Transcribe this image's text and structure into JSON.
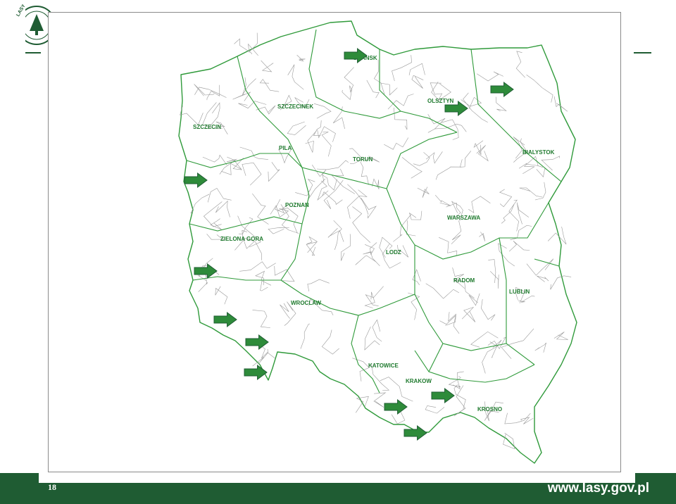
{
  "page_number": "18",
  "website": "www.lasy.gov.pl",
  "logo": {
    "text": "LASY P",
    "color": "#1f5c33"
  },
  "colors": {
    "brand_green": "#1f5c33",
    "boundary_green": "#2f9a3a",
    "arrow_green": "#2e8b3a",
    "label_green": "#1f7a2e"
  },
  "map": {
    "regions": [
      {
        "name": "SZCZECINEK",
        "lon": 16.7,
        "lat": 53.7
      },
      {
        "name": "GDANSK",
        "lon": 18.6,
        "lat": 54.35
      },
      {
        "name": "OLSZTYN",
        "lon": 20.5,
        "lat": 53.78
      },
      {
        "name": "BIALYSTOK",
        "lon": 22.9,
        "lat": 53.1
      },
      {
        "name": "SZCZECIN",
        "lon": 14.55,
        "lat": 53.43
      },
      {
        "name": "PILA",
        "lon": 16.74,
        "lat": 53.15
      },
      {
        "name": "TORUN",
        "lon": 18.6,
        "lat": 53.0
      },
      {
        "name": "WARSZAWA",
        "lon": 21.0,
        "lat": 52.23
      },
      {
        "name": "POZNAN",
        "lon": 16.9,
        "lat": 52.4
      },
      {
        "name": "LODZ",
        "lon": 19.45,
        "lat": 51.77
      },
      {
        "name": "ZIELONA GORA",
        "lon": 15.25,
        "lat": 51.95
      },
      {
        "name": "RADOM",
        "lon": 21.15,
        "lat": 51.4
      },
      {
        "name": "LUBLIN",
        "lon": 22.57,
        "lat": 51.25
      },
      {
        "name": "WROCLAW",
        "lon": 17.03,
        "lat": 51.1
      },
      {
        "name": "KATOWICE",
        "lon": 19.0,
        "lat": 50.27
      },
      {
        "name": "KRAKOW",
        "lon": 19.95,
        "lat": 50.06
      },
      {
        "name": "KROSNO",
        "lon": 21.77,
        "lat": 49.69
      }
    ],
    "arrows": [
      {
        "lon": 18.4,
        "lat": 54.4
      },
      {
        "lon": 20.95,
        "lat": 53.7
      },
      {
        "lon": 22.1,
        "lat": 53.95
      },
      {
        "lon": 14.35,
        "lat": 52.75
      },
      {
        "lon": 14.6,
        "lat": 51.55
      },
      {
        "lon": 15.1,
        "lat": 50.9
      },
      {
        "lon": 15.9,
        "lat": 50.6
      },
      {
        "lon": 15.85,
        "lat": 50.2
      },
      {
        "lon": 19.4,
        "lat": 49.75
      },
      {
        "lon": 20.6,
        "lat": 49.9
      },
      {
        "lon": 19.9,
        "lat": 49.4
      }
    ]
  }
}
